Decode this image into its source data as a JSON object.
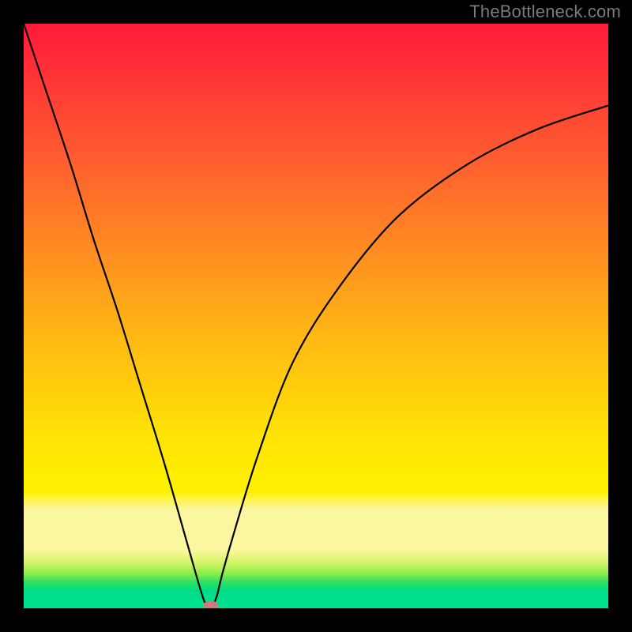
{
  "watermark": "TheBottleneck.com",
  "colors": {
    "page_bg": "#000000",
    "gradient_top": "#ff1b3a",
    "gradient_mid": "#ffe205",
    "gradient_bottom": "#00e28f",
    "curve": "#000000",
    "marker": "#cf7b7b"
  },
  "chart_data": {
    "type": "line",
    "title": "",
    "xlabel": "",
    "ylabel": "",
    "xlim": [
      0,
      100
    ],
    "ylim": [
      0,
      100
    ],
    "background": "vertical-gradient red→yellow→green",
    "x": [
      0,
      4,
      8,
      12,
      16,
      20,
      24,
      28,
      30,
      31,
      32,
      33,
      34,
      36,
      40,
      46,
      54,
      64,
      76,
      88,
      100
    ],
    "values": [
      100,
      88,
      76,
      63,
      51,
      38,
      25,
      11,
      4,
      1,
      0,
      2,
      6,
      13,
      26,
      42,
      55,
      67,
      76,
      82,
      86
    ],
    "annotations": [
      {
        "type": "marker",
        "shape": "ellipse",
        "x": 32,
        "y": 0.5,
        "rx": 1.2,
        "ry": 0.7,
        "note": "minimum indicator"
      }
    ],
    "note": "x and y are expressed as percent of the plot width/height; y measured from bottom (0) to top (100). Values estimated visually from gradient position."
  }
}
